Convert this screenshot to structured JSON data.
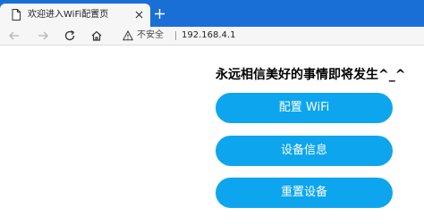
{
  "browser": {
    "tab_title": "欢迎进入WiFi配置页",
    "security_label": "不安全",
    "url": "192.168.4.1"
  },
  "page": {
    "heading": "永远相信美好的事情即将发生^_^",
    "buttons": [
      "配置 WiFi",
      "设备信息",
      "重置设备"
    ]
  },
  "colors": {
    "tabstrip": "#1a6fd6",
    "button": "#0ea5ef",
    "button_text": "#ffffff"
  },
  "icons": [
    "page-icon",
    "close-icon",
    "plus-icon",
    "back-arrow-icon",
    "forward-arrow-icon",
    "reload-icon",
    "home-icon",
    "warning-icon"
  ]
}
